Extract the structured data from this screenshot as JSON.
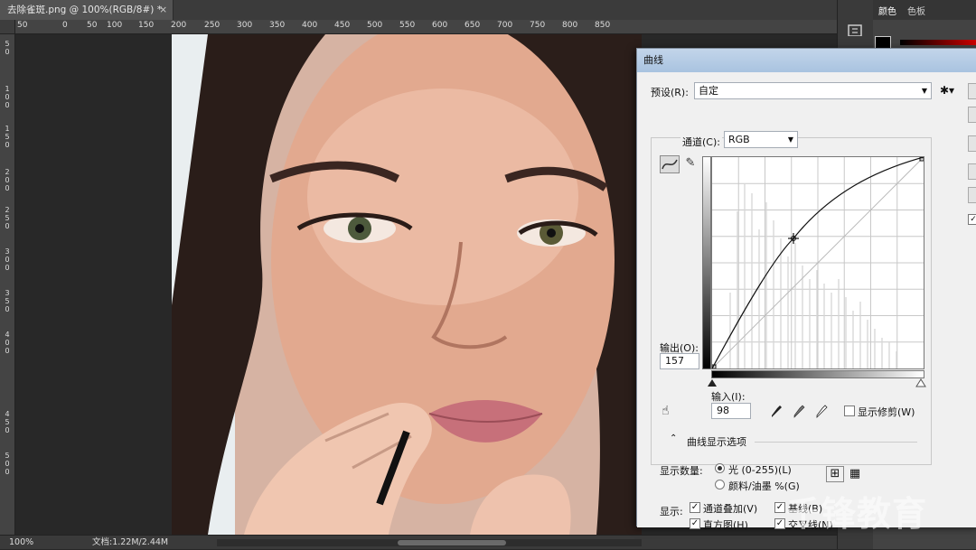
{
  "document": {
    "tab_title": "去除雀斑.png @ 100%(RGB/8#) *",
    "close_glyph": "×",
    "ruler_top": [
      "50",
      "0",
      "50",
      "100",
      "150",
      "200",
      "250",
      "300",
      "350",
      "400",
      "450",
      "500",
      "550",
      "600",
      "650",
      "700",
      "750",
      "800",
      "850"
    ],
    "ruler_left": [
      "5\n0",
      "1\n0\n0",
      "1\n5\n0",
      "2\n0\n0",
      "2\n5\n0",
      "3\n0\n0",
      "3\n5\n0",
      "4\n0\n0",
      "4\n5\n0",
      "5\n0\n0"
    ]
  },
  "status": {
    "zoom": "100%",
    "doc_info": "文档:1.22M/2.44M"
  },
  "right_panel": {
    "tab_color": "颜色",
    "tab_swatches": "色板"
  },
  "watermark": "千锋教育",
  "curves": {
    "title": "曲线",
    "preset_label": "预设(R):",
    "preset_value": "自定",
    "channel_label": "通道(C):",
    "channel_value": "RGB",
    "output_label": "输出(O):",
    "output_value": "157",
    "input_label": "输入(I):",
    "input_value": "98",
    "show_clipping": "显示修剪(W)",
    "curve_display_options": "曲线显示选项",
    "show_amount_label": "显示数量:",
    "light_option": "光 (0-255)(L)",
    "pigment_option": "颜料/油墨 %(G)",
    "show_label": "显示:",
    "channel_overlay": "通道叠加(V)",
    "baseline": "基线(B)",
    "histogram": "直方图(H)",
    "intersection_line": "交叉线(N)"
  }
}
